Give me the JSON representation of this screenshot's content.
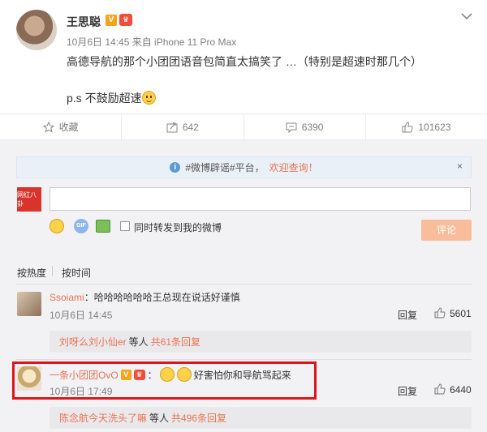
{
  "post": {
    "author": "王思聪",
    "meta": "10月6日 14:45 来自 iPhone 11 Pro Max",
    "text": "高德导航的那个小团团语音包简直太搞笑了 …（特别是超速时那几个）",
    "ps": "p.s 不鼓励超速",
    "v_badge": "V",
    "crown_icon": "♛"
  },
  "actions": {
    "favorite": "收藏",
    "forward": "642",
    "comment": "6390",
    "like": "101623"
  },
  "notice": {
    "prefix": "#微博辟谣#平台，",
    "link": "欢迎查询！",
    "close": "×"
  },
  "composer": {
    "avatar_text": "网红八卦",
    "forward_label": "同时转发到我的微博",
    "submit": "评论"
  },
  "sort": {
    "hot": "按热度",
    "time": "按时间"
  },
  "comments": [
    {
      "user": "Ssoiami",
      "text": "：哈哈哈哈哈哈王总现在说话好谨慎",
      "time": "10月6日 14:45",
      "reply": "回复",
      "likes": "5601",
      "sub_user": "刘呀么刘小仙er",
      "sub_mid": "等人",
      "sub_count": "共61条回复"
    },
    {
      "user": "一条小团团OvO",
      "text": "好害怕你和导航骂起来",
      "colon": "：",
      "time": "10月6日 17:49",
      "reply": "回复",
      "likes": "6440",
      "sub_user": "陈念航今天洗头了嘛",
      "sub_mid": "等人",
      "sub_count": "共496条回复"
    }
  ],
  "colors": {
    "accent": "#eb7350",
    "highlight": "#e0141b",
    "submit_bg": "#f9bd9c"
  }
}
